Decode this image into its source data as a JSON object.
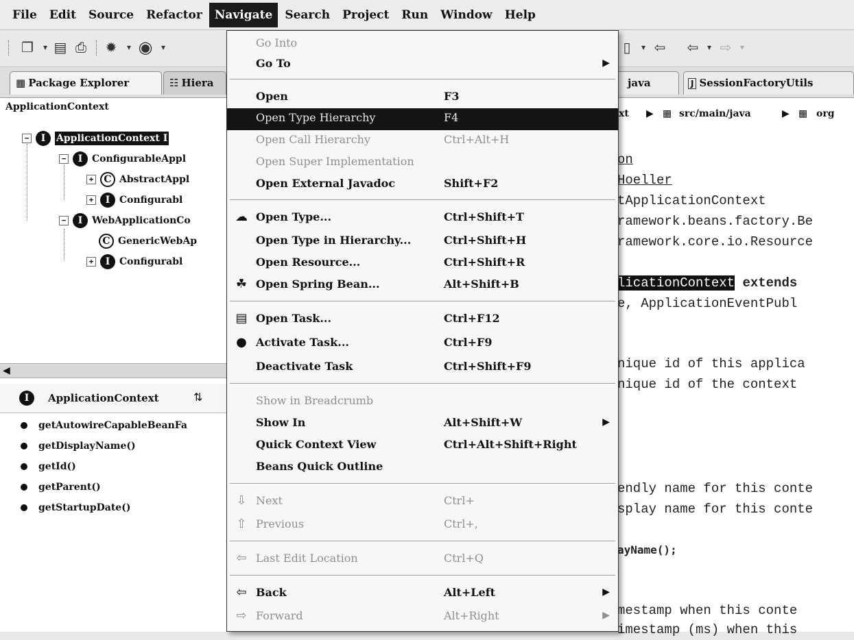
{
  "menubar": {
    "items": [
      "File",
      "Edit",
      "Source",
      "Refactor",
      "Navigate",
      "Search",
      "Project",
      "Run",
      "Window",
      "Help"
    ],
    "active": "Navigate"
  },
  "left": {
    "tabs": [
      "Package Explorer",
      "Hiera"
    ],
    "hierarchy_title": "ApplicationContext",
    "tree": [
      "ApplicationContext I",
      "ConfigurableAppl",
      "AbstractAppl",
      "Configurabl",
      "WebApplicationCo",
      "GenericWebAp",
      "Configurabl"
    ],
    "members_title": "ApplicationContext",
    "methods": [
      "getAutowireCapableBeanFa",
      "getDisplayName()",
      "getId()",
      "getParent()",
      "getStartupDate()"
    ]
  },
  "editor": {
    "tabs": [
      "java",
      "SessionFactoryUtils"
    ],
    "breadcrumb": [
      "xt",
      "src/main/java",
      "org"
    ],
    "code": [
      "on",
      "Hoeller",
      "tApplicationContext",
      "ramework.beans.factory.Be",
      "ramework.core.io.Resource",
      "licationContext",
      "extends",
      "e, ApplicationEventPubl",
      "nique id of this applica",
      "nique id of the context",
      "endly name for this conte",
      "splay name for this conte",
      "ayName();",
      "mestamp when this conte",
      "imestamp (ms) when this"
    ]
  },
  "navigate_menu": {
    "items": [
      {
        "label": "Go Into",
        "shortcut": "",
        "disabled": true
      },
      {
        "label": "Go To",
        "shortcut": "",
        "submenu": true
      },
      {
        "label": "Open",
        "shortcut": "F3"
      },
      {
        "label": "Open Type Hierarchy",
        "shortcut": "F4",
        "selected": true
      },
      {
        "label": "Open Call Hierarchy",
        "shortcut": "Ctrl+Alt+H",
        "disabled": true
      },
      {
        "label": "Open Super Implementation",
        "shortcut": "",
        "disabled": true
      },
      {
        "label": "Open External Javadoc",
        "shortcut": "Shift+F2"
      },
      {
        "label": "Open Type...",
        "shortcut": "Ctrl+Shift+T"
      },
      {
        "label": "Open Type in Hierarchy...",
        "shortcut": "Ctrl+Shift+H"
      },
      {
        "label": "Open Resource...",
        "shortcut": "Ctrl+Shift+R"
      },
      {
        "label": "Open Spring Bean...",
        "shortcut": "Alt+Shift+B"
      },
      {
        "label": "Open Task...",
        "shortcut": "Ctrl+F12"
      },
      {
        "label": "Activate Task...",
        "shortcut": "Ctrl+F9"
      },
      {
        "label": "Deactivate Task",
        "shortcut": "Ctrl+Shift+F9"
      },
      {
        "label": "Show in Breadcrumb",
        "shortcut": "",
        "disabled": true
      },
      {
        "label": "Show In",
        "shortcut": "Alt+Shift+W",
        "submenu": true
      },
      {
        "label": "Quick Context View",
        "shortcut": "Ctrl+Alt+Shift+Right"
      },
      {
        "label": "Beans Quick Outline",
        "shortcut": ""
      },
      {
        "label": "Next",
        "shortcut": "Ctrl+",
        "disabled": true
      },
      {
        "label": "Previous",
        "shortcut": "Ctrl+,",
        "disabled": true
      },
      {
        "label": "Last Edit Location",
        "shortcut": "Ctrl+Q",
        "disabled": true
      },
      {
        "label": "Back",
        "shortcut": "Alt+Left",
        "submenu": true
      },
      {
        "label": "Forward",
        "shortcut": "Alt+Right",
        "submenu": true,
        "disabled": true
      }
    ]
  }
}
